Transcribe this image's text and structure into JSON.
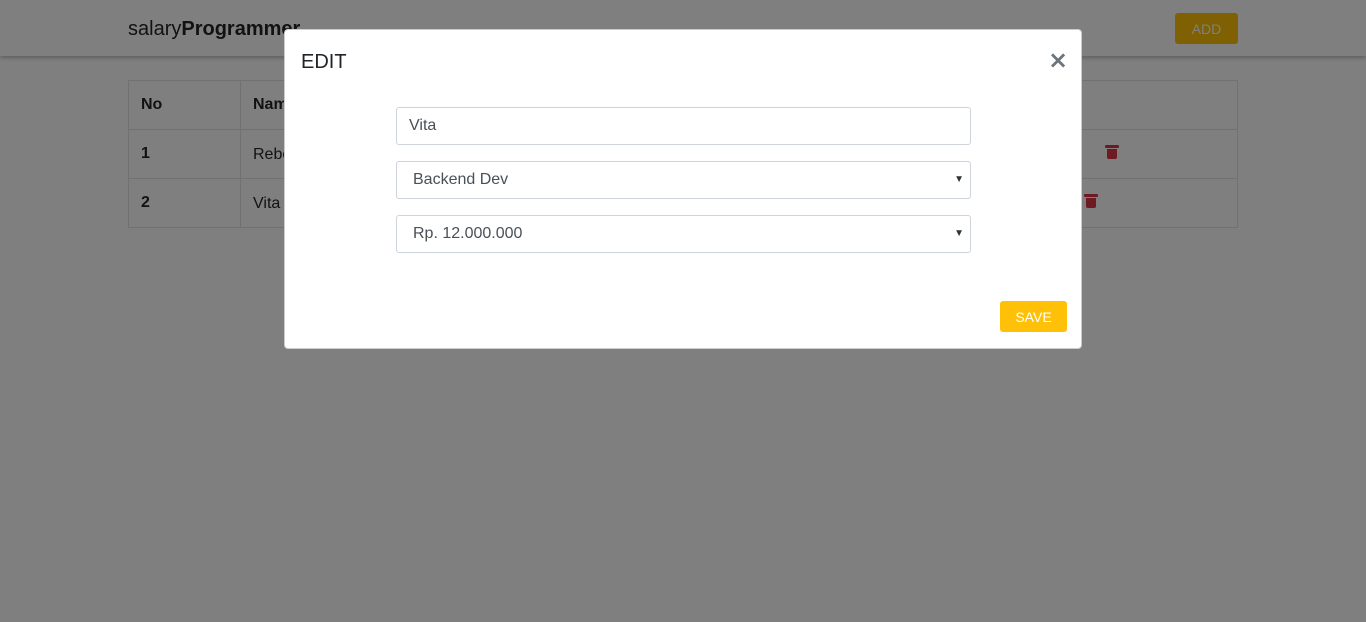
{
  "navbar": {
    "brand_light": "salary",
    "brand_bold": "Programmer",
    "add_label": "ADD"
  },
  "table": {
    "headers": [
      "No",
      "Name"
    ],
    "rows": [
      {
        "no": "1",
        "name": "Rebecca",
        "action_icon": "trash-icon"
      },
      {
        "no": "2",
        "name": "Vita",
        "action_icon": "trash-icon"
      }
    ]
  },
  "modal": {
    "title": "EDIT",
    "close_symbol": "×",
    "name_value": "Vita",
    "role_selected": "Backend Dev",
    "salary_selected": "Rp. 12.000.000",
    "save_label": "SAVE"
  },
  "colors": {
    "accent": "#ffc107",
    "danger": "#dc3545",
    "backdrop": "rgba(0,0,0,0.5)"
  }
}
